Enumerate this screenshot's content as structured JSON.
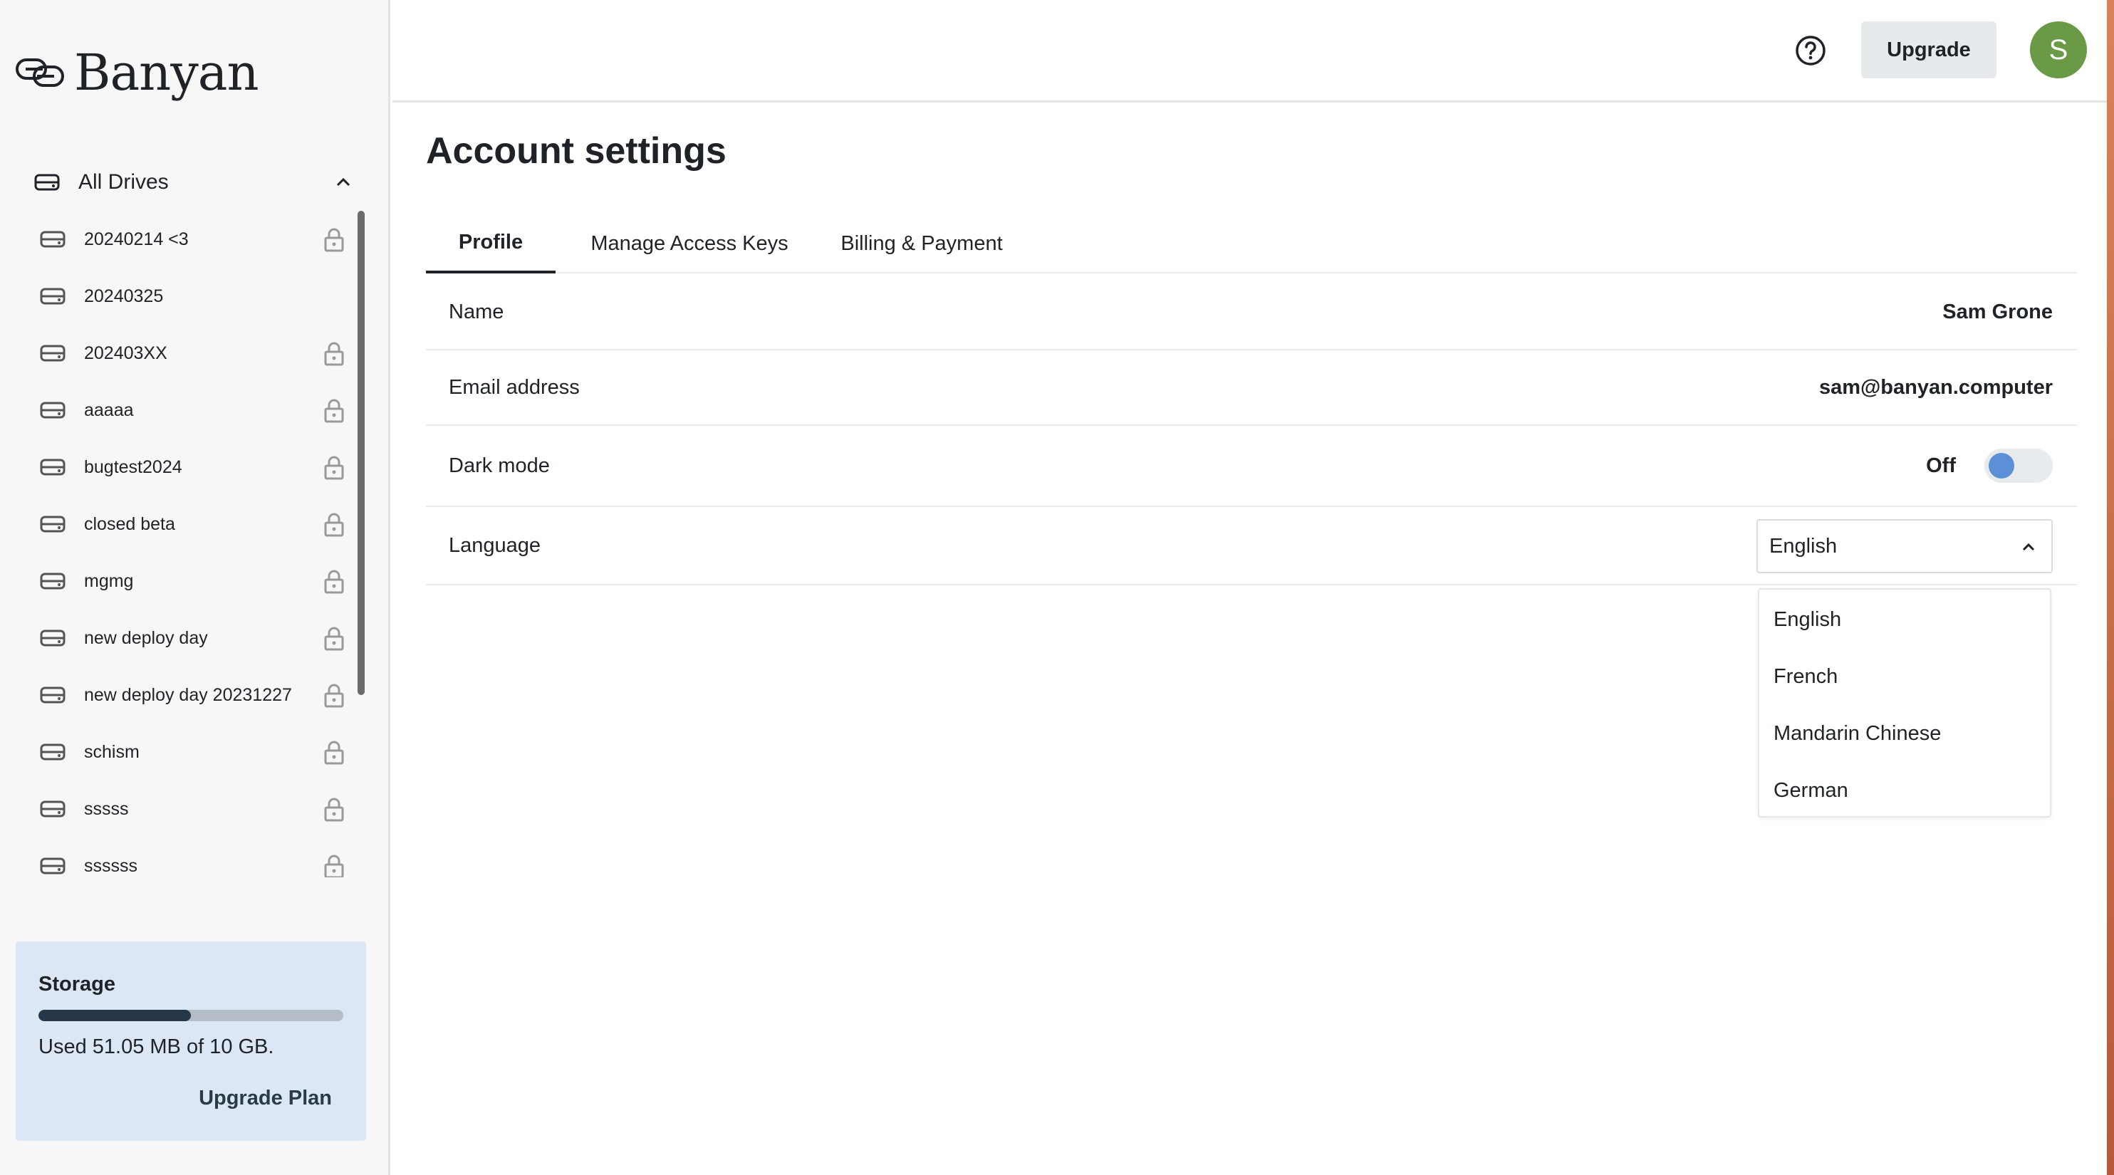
{
  "sidebar": {
    "logo_text": "Banyan",
    "drives_label": "All Drives",
    "drives": [
      {
        "name": "20240214 <3",
        "locked": true
      },
      {
        "name": "20240325",
        "locked": false
      },
      {
        "name": "202403XX",
        "locked": true
      },
      {
        "name": "aaaaa",
        "locked": true
      },
      {
        "name": "bugtest2024",
        "locked": true
      },
      {
        "name": "closed beta",
        "locked": true
      },
      {
        "name": "mgmg",
        "locked": true
      },
      {
        "name": "new deploy day",
        "locked": true
      },
      {
        "name": "new deploy day 20231227",
        "locked": true
      },
      {
        "name": "schism",
        "locked": true
      },
      {
        "name": "sssss",
        "locked": true
      },
      {
        "name": "ssssss",
        "locked": true
      }
    ],
    "storage": {
      "title": "Storage",
      "used_text": "Used 51.05 MB of 10 GB.",
      "used_fraction": 0.5,
      "upgrade_label": "Upgrade Plan"
    }
  },
  "topbar": {
    "help_icon": "help-circle-icon",
    "upgrade_label": "Upgrade",
    "avatar_initial": "S",
    "avatar_color": "#6b9a46"
  },
  "main": {
    "title": "Account settings",
    "tabs": [
      {
        "label": "Profile",
        "active": true
      },
      {
        "label": "Manage Access Keys",
        "active": false
      },
      {
        "label": "Billing & Payment",
        "active": false
      }
    ],
    "profile": {
      "name_label": "Name",
      "name_value": "Sam Grone",
      "email_label": "Email address",
      "email_value": "sam@banyan.computer",
      "dark_mode_label": "Dark mode",
      "dark_mode_state": "Off",
      "language_label": "Language",
      "language_value": "English",
      "language_options": [
        "English",
        "French",
        "Mandarin Chinese",
        "German"
      ]
    }
  },
  "colors": {
    "toggle_knob": "#5b8fd6",
    "storage_bg": "#dbe7f5",
    "storage_bar_fill": "#26374a"
  }
}
